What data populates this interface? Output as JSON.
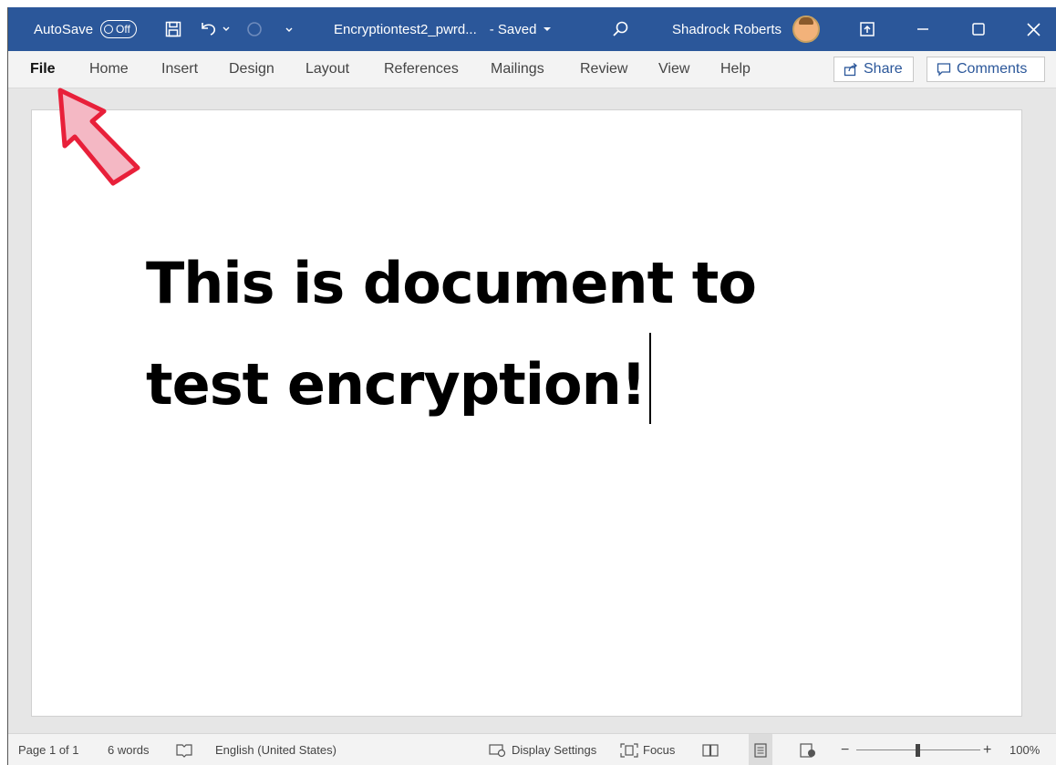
{
  "titlebar": {
    "autosave_label": "AutoSave",
    "autosave_state": "Off",
    "doc_name": "Encryptiontest2_pwrd...",
    "save_state": "- Saved",
    "user_name": "Shadrock Roberts",
    "bg_color": "#2b579a"
  },
  "ribbon": {
    "tabs": [
      "File",
      "Home",
      "Insert",
      "Design",
      "Layout",
      "References",
      "Mailings",
      "Review",
      "View",
      "Help"
    ],
    "share_label": "Share",
    "comments_label": "Comments"
  },
  "document": {
    "line1": "This is document to",
    "line2": "test encryption!"
  },
  "statusbar": {
    "page": "Page 1 of 1",
    "words": "6 words",
    "language": "English (United States)",
    "display_settings": "Display Settings",
    "focus": "Focus",
    "zoom_minus": "−",
    "zoom_plus": "+",
    "zoom": "100%"
  },
  "icons": [
    "save-icon",
    "undo-icon",
    "redo-icon",
    "customize-qat-icon",
    "search-icon",
    "ribbon-display-icon",
    "minimize-icon",
    "maximize-icon",
    "close-icon",
    "share-icon",
    "comment-icon",
    "proofing-icon",
    "display-settings-icon",
    "focus-icon",
    "read-mode-icon",
    "print-layout-icon",
    "web-layout-icon"
  ],
  "annotation_color": "#e8203a"
}
